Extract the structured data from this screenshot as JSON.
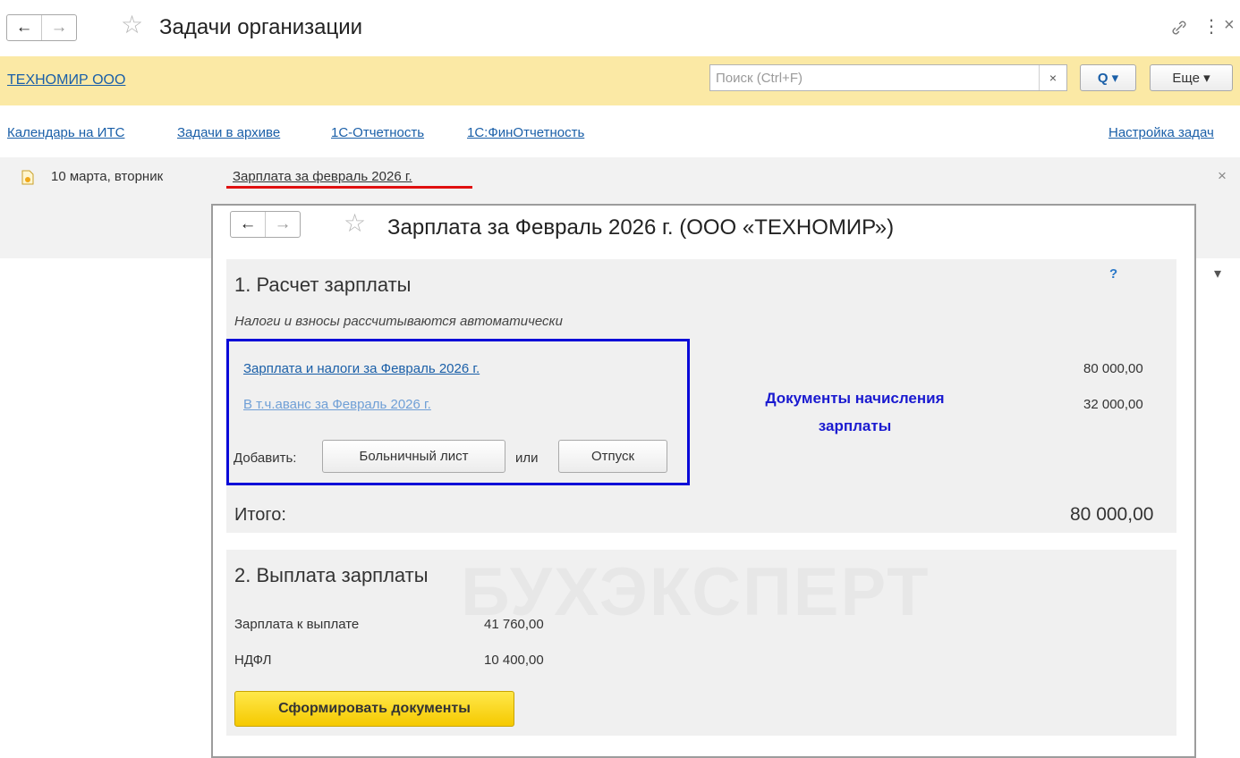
{
  "window": {
    "title": "Задачи организации",
    "back_icon": "←",
    "forward_icon": "→",
    "star_icon": "☆",
    "link_icon": "🔗",
    "more_icon": "⋮",
    "close_icon": "×"
  },
  "org_bar": {
    "org_name": "ТЕХНОМИР ООО",
    "search_placeholder": "Поиск (Ctrl+F)",
    "search_clear": "×",
    "search_button_icon": "Q ▾",
    "more_button": "Еще ▾"
  },
  "links": {
    "items": [
      "Календарь на ИТС",
      "Задачи в архиве",
      "1С-Отчетность",
      "1С:ФинОтчетность"
    ],
    "settings": "Настройка задач"
  },
  "task": {
    "date": "10 марта, вторник",
    "title": "Зарплата за февраль 2026 г.",
    "close": "×",
    "expand_icon": "▾"
  },
  "form": {
    "title": "Зарплата за Февраль 2026 г. (ООО «ТЕХНОМИР»)",
    "help": "?",
    "section1": {
      "heading": "1. Расчет зарплаты",
      "note": "Налоги и взносы рассчитываются автоматически",
      "doc_link": "Зарплата и налоги за Февраль 2026 г.",
      "doc_amount": "80 000,00",
      "advance_link": "В т.ч.аванс за Февраль 2026 г.",
      "advance_amount": "32 000,00",
      "add_label": "Добавить:",
      "sick_button": "Больничный лист",
      "or_label": "или",
      "vacation_button": "Отпуск",
      "annotation": "Документы начисления зарплаты",
      "total_label": "Итого:",
      "total_amount": "80 000,00"
    },
    "section2": {
      "heading": "2. Выплата зарплаты",
      "pay_label": "Зарплата к выплате",
      "pay_amount": "41 760,00",
      "ndfl_label": "НДФЛ",
      "ndfl_amount": "10 400,00",
      "generate_button": "Сформировать документы"
    },
    "watermark": "БУХЭКСПЕРТ"
  },
  "colors": {
    "org_bar": "#fbe9a5",
    "link": "#1a5fa8",
    "annotation": "#1a1ad0",
    "highlight_box": "#0a0ad8",
    "underline_red": "#e01010",
    "yellow_button": "#f5c900"
  }
}
